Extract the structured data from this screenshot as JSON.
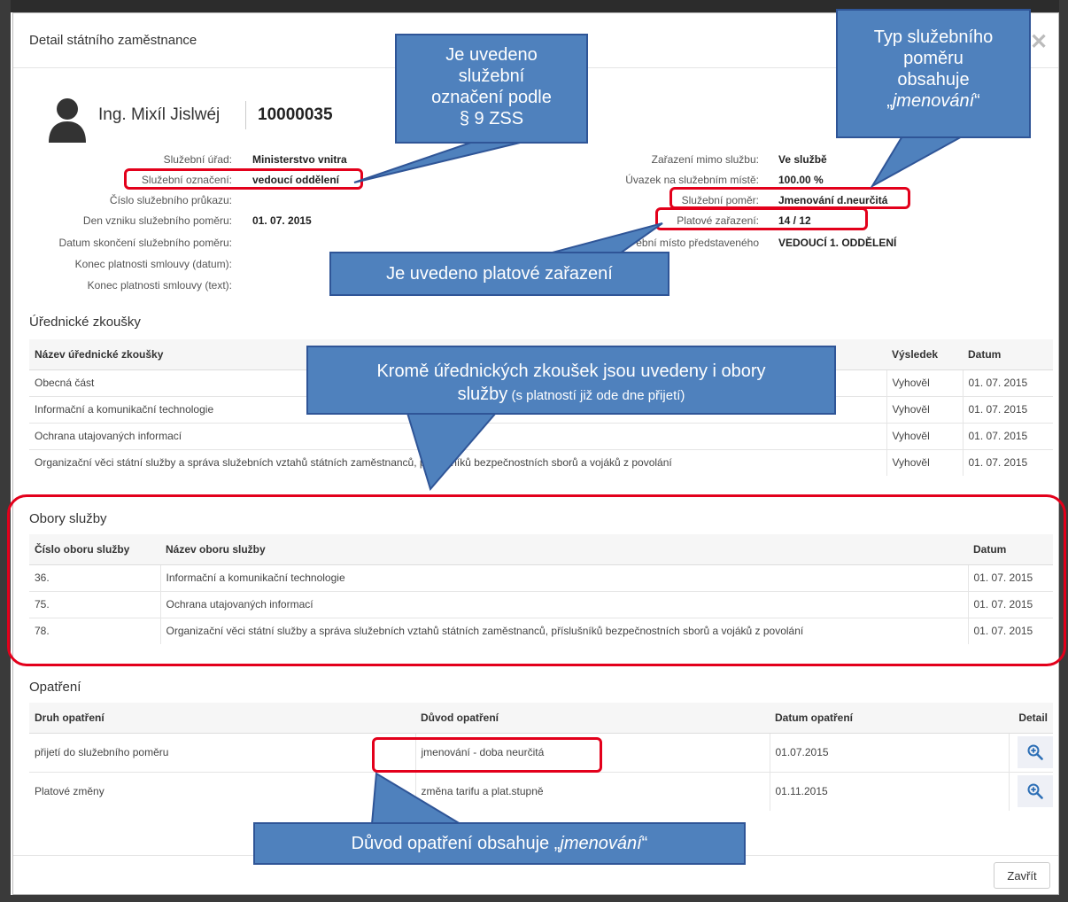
{
  "modal": {
    "title": "Detail státního zaměstnance",
    "close_symbol": "✕",
    "close_button_label": "Zavřít"
  },
  "person": {
    "name": "Ing. Mixíl Jislwéj",
    "id": "10000035",
    "avatar_icon": "user-silhouette-icon"
  },
  "info_left": [
    {
      "label": "Služební úřad:",
      "value": "Ministerstvo vnitra"
    },
    {
      "label": "Služební označení:",
      "value": "vedoucí oddělení"
    },
    {
      "label": "Číslo služebního průkazu:",
      "value": ""
    },
    {
      "label": "Den vzniku služebního poměru:",
      "value": "01. 07. 2015"
    },
    {
      "label": "Datum skončení služebního poměru:",
      "value": ""
    },
    {
      "label": "Konec platnosti smlouvy (datum):",
      "value": ""
    },
    {
      "label": "Konec platnosti smlouvy (text):",
      "value": ""
    }
  ],
  "info_right": [
    {
      "label": "Zařazení mimo službu:",
      "value": "Ve službě"
    },
    {
      "label": "Úvazek na služebním místě:",
      "value": "100.00 %"
    },
    {
      "label": "Služební poměr:",
      "value": "Jmenování d.neurčitá"
    },
    {
      "label": "Platové zařazení:",
      "value": "14 / 12"
    },
    {
      "label": "ební místo představeného",
      "value": "VEDOUCÍ 1. ODDĚLENÍ"
    }
  ],
  "exams": {
    "title": "Úřednické zkoušky",
    "headers": [
      "Název úřednické zkoušky",
      "Výsledek",
      "Datum"
    ],
    "rows": [
      [
        "Obecná část",
        "Vyhověl",
        "01. 07. 2015"
      ],
      [
        "Informační a komunikační technologie",
        "Vyhověl",
        "01. 07. 2015"
      ],
      [
        "Ochrana utajovaných informací",
        "Vyhověl",
        "01. 07. 2015"
      ],
      [
        "Organizační věci státní služby a správa služebních vztahů státních zaměstnanců, příslušníků bezpečnostních sborů a vojáků z povolání",
        "Vyhověl",
        "01. 07. 2015"
      ]
    ]
  },
  "fields": {
    "title": "Obory služby",
    "headers": [
      "Číslo oboru služby",
      "Název oboru služby",
      "Datum"
    ],
    "rows": [
      [
        "36.",
        "Informační a komunikační technologie",
        "01. 07. 2015"
      ],
      [
        "75.",
        "Ochrana utajovaných informací",
        "01. 07. 2015"
      ],
      [
        "78.",
        "Organizační věci státní služby a správa služebních vztahů státních zaměstnanců, příslušníků bezpečnostních sborů a vojáků z povolání",
        "01. 07. 2015"
      ]
    ]
  },
  "measures": {
    "title": "Opatření",
    "headers": [
      "Druh opatření",
      "Důvod opatření",
      "Datum opatření",
      "Detail"
    ],
    "rows": [
      [
        "přijetí do služebního poměru",
        "jmenování - doba neurčitá",
        "01.07.2015"
      ],
      [
        "Platové změny",
        "změna tarifu a plat.stupně",
        "01.11.2015"
      ]
    ],
    "detail_icon": "zoom-in-icon"
  },
  "callouts": {
    "designation_lines": [
      "Je uvedeno",
      "služební",
      "označení podle",
      "§ 9 ZSS"
    ],
    "type_lines": [
      "Typ služebního",
      "poměru",
      "obsahuje"
    ],
    "type_quote_open": "„",
    "type_quote_word": "jmenování",
    "type_quote_close": "“",
    "salary": "Je uvedeno platové zařazení",
    "exams_line1": "Kromě úřednických zkoušek jsou uvedeny i obory",
    "exams_line2_big": "služby",
    "exams_line2_small": " (s platností již ode dne přijetí)",
    "reason_prefix": "Důvod opatření obsahuje „",
    "reason_word": "jmenování",
    "reason_suffix": "“"
  },
  "colors": {
    "highlight": "#e3001b",
    "callout_fill": "#4f81bd",
    "callout_border": "#2f5597"
  }
}
